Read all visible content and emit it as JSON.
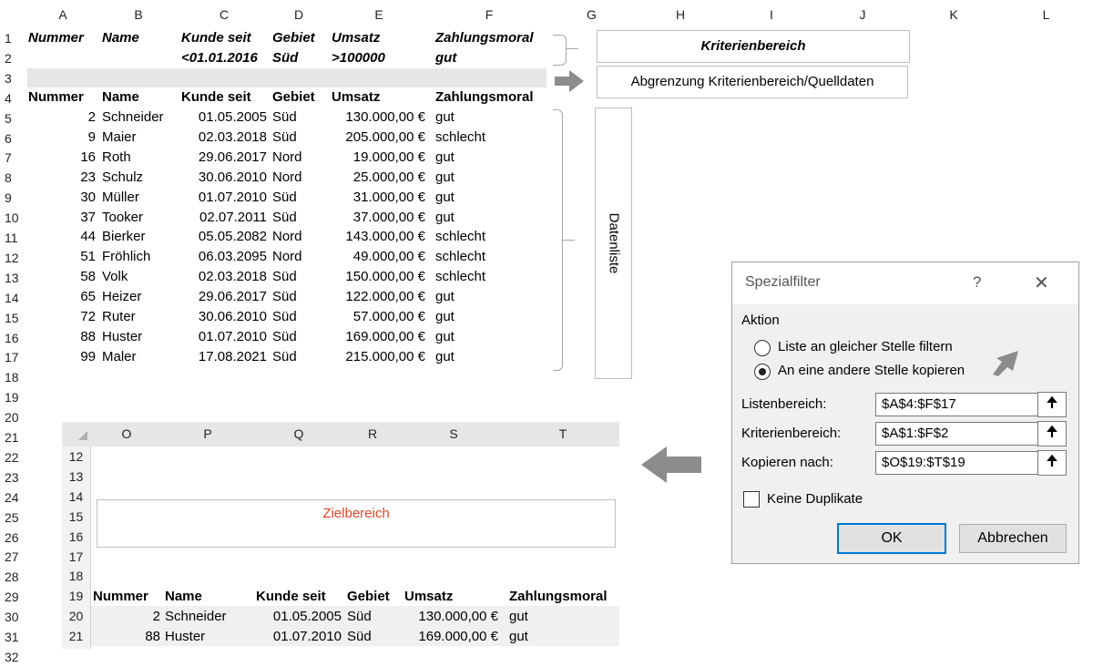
{
  "sheet": {
    "columns": [
      "A",
      "B",
      "C",
      "D",
      "E",
      "F",
      "G",
      "H",
      "I",
      "J",
      "K",
      "L"
    ],
    "row_numbers": [
      "1",
      "2",
      "3",
      "4",
      "5",
      "6",
      "7",
      "8",
      "9",
      "10",
      "11",
      "12",
      "13",
      "14",
      "15",
      "16",
      "17",
      "18",
      "19",
      "20",
      "21",
      "22",
      "23",
      "24",
      "25",
      "26",
      "27",
      "28",
      "29",
      "30",
      "31",
      "32"
    ],
    "criteria_header": [
      "Nummer",
      "Name",
      "Kunde seit",
      "Gebiet",
      "Umsatz",
      "Zahlungsmoral"
    ],
    "criteria_values": [
      "<01.01.2016",
      "Süd",
      ">100000",
      "gut"
    ],
    "data_header": [
      "Nummer",
      "Name",
      "Kunde seit",
      "Gebiet",
      "Umsatz",
      "Zahlungsmoral"
    ],
    "rows": [
      [
        "2",
        "Schneider",
        "01.05.2005",
        "Süd",
        "130.000,00 €",
        "gut"
      ],
      [
        "9",
        "Maier",
        "02.03.2018",
        "Süd",
        "205.000,00 €",
        "schlecht"
      ],
      [
        "16",
        "Roth",
        "29.06.2017",
        "Nord",
        "19.000,00 €",
        "gut"
      ],
      [
        "23",
        "Schulz",
        "30.06.2010",
        "Nord",
        "25.000,00 €",
        "gut"
      ],
      [
        "30",
        "Müller",
        "01.07.2010",
        "Süd",
        "31.000,00 €",
        "gut"
      ],
      [
        "37",
        "Tooker",
        "02.07.2011",
        "Süd",
        "37.000,00 €",
        "gut"
      ],
      [
        "44",
        "Bierker",
        "05.05.2082",
        "Nord",
        "143.000,00 €",
        "schlecht"
      ],
      [
        "51",
        "Fröhlich",
        "06.03.2095",
        "Nord",
        "49.000,00 €",
        "schlecht"
      ],
      [
        "58",
        "Volk",
        "02.03.2018",
        "Süd",
        "150.000,00 €",
        "schlecht"
      ],
      [
        "65",
        "Heizer",
        "29.06.2017",
        "Süd",
        "122.000,00 €",
        "gut"
      ],
      [
        "72",
        "Ruter",
        "30.06.2010",
        "Süd",
        "57.000,00 €",
        "gut"
      ],
      [
        "88",
        "Huster",
        "01.07.2010",
        "Süd",
        "169.000,00 €",
        "gut"
      ],
      [
        "99",
        "Maler",
        "17.08.2021",
        "Süd",
        "215.000,00 €",
        "gut"
      ]
    ],
    "label_kriterienbereich": "Kriterienbereich",
    "label_abgrenzung": "Abgrenzung Kriterienbereich/Quelldaten",
    "label_datenliste": "Datenliste"
  },
  "inner_sheet": {
    "columns": [
      "O",
      "P",
      "Q",
      "R",
      "S",
      "T"
    ],
    "row_numbers": [
      "12",
      "13",
      "14",
      "15",
      "16",
      "17",
      "18",
      "19",
      "20",
      "21"
    ],
    "label_zielbereich": "Zielbereich",
    "header": [
      "Nummer",
      "Name",
      "Kunde seit",
      "Gebiet",
      "Umsatz",
      "Zahlungsmoral"
    ],
    "rows": [
      [
        "2",
        "Schneider",
        "01.05.2005",
        "Süd",
        "130.000,00 €",
        "gut"
      ],
      [
        "88",
        "Huster",
        "01.07.2010",
        "Süd",
        "169.000,00 €",
        "gut"
      ]
    ]
  },
  "dialog": {
    "title": "Spezialfilter",
    "help": "?",
    "close": "✕",
    "group_label": "Aktion",
    "option1": "Liste an gleicher Stelle filtern",
    "option2": "An eine andere Stelle kopieren",
    "option2_selected": true,
    "listenbereich_label": "Listenbereich:",
    "listenbereich_value": "$A$4:$F$17",
    "kriterienbereich_label": "Kriterienbereich:",
    "kriterienbereich_value": "$A$1:$F$2",
    "kopieren_label": "Kopieren nach:",
    "kopieren_value": "$O$19:$T$19",
    "collapse_icon": "upload-arrow-icon",
    "keine_duplikate": "Keine Duplikate",
    "ok": "OK",
    "cancel": "Abbrechen"
  },
  "colors": {
    "zielbereich_text": "#e0452a",
    "arrow": "#8c8c8c",
    "focus": "#0078d7"
  }
}
